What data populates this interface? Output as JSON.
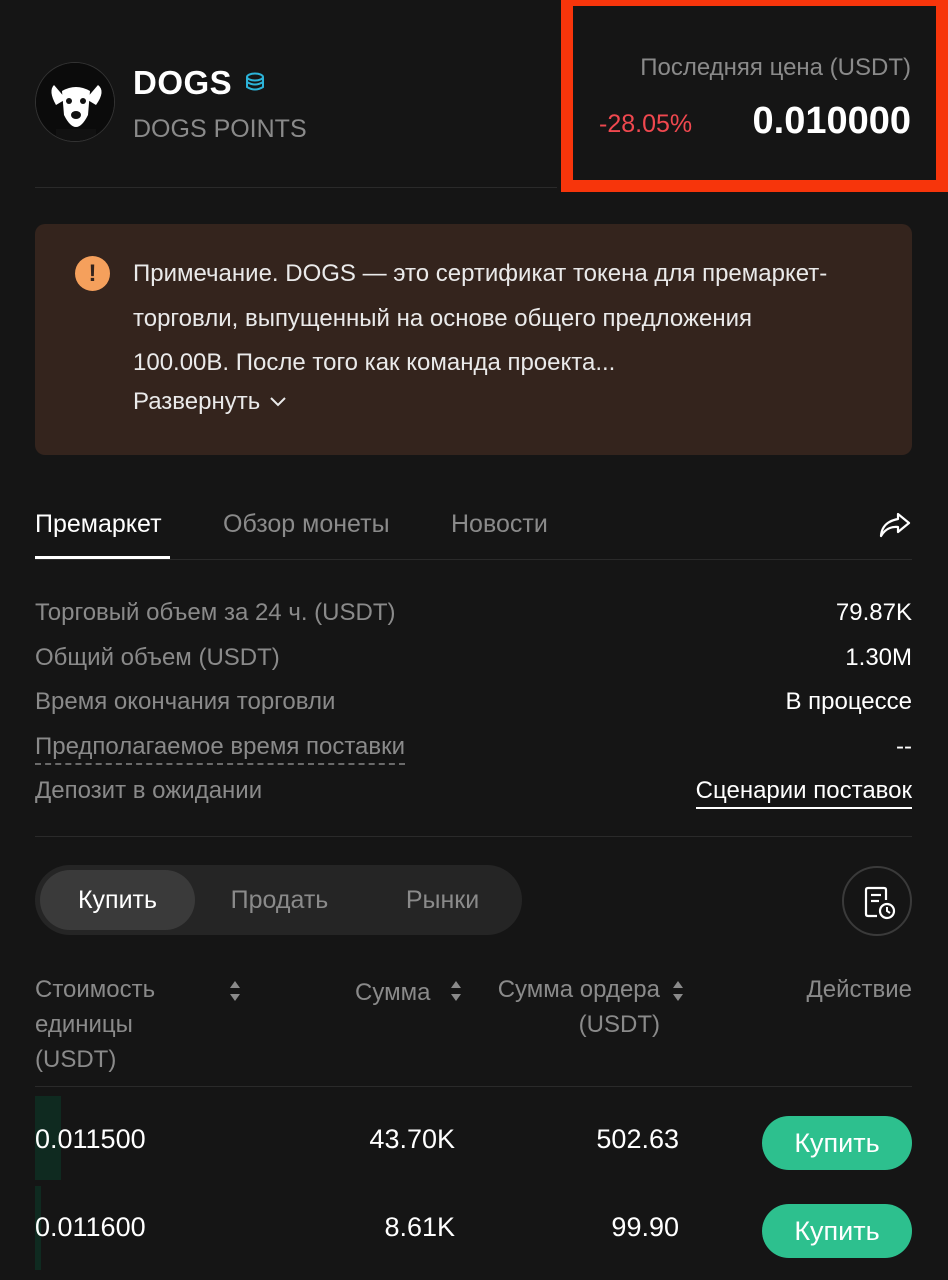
{
  "header": {
    "coin_name": "DOGS",
    "coin_subtitle": "DOGS POINTS",
    "price_label": "Последняя цена (USDT)",
    "price_change": "-28.05%",
    "price_value": "0.010000",
    "colors": {
      "negative": "#f0484f",
      "highlight_border": "#f7350b"
    }
  },
  "notice": {
    "icon": "warning-icon",
    "text": "Примечание. DOGS — это сертификат токена для премаркет-торговли, выпущенный на основе общего предложения 100.00B. После того как команда проекта...",
    "expand_label": "Развернуть"
  },
  "tabs": [
    {
      "label": "Премаркет",
      "active": true
    },
    {
      "label": "Обзор монеты",
      "active": false
    },
    {
      "label": "Новости",
      "active": false
    }
  ],
  "info": [
    {
      "label": "Торговый объем за 24 ч. (USDT)",
      "value": "79.87K"
    },
    {
      "label": "Общий объем (USDT)",
      "value": "1.30M"
    },
    {
      "label": "Время окончания торговли",
      "value": "В процессе"
    },
    {
      "label": "Предполагаемое время поставки",
      "value": "--"
    },
    {
      "label": "Депозит в ожидании",
      "value": "Сценарии поставок"
    }
  ],
  "segments": [
    {
      "label": "Купить",
      "active": true
    },
    {
      "label": "Продать",
      "active": false
    },
    {
      "label": "Рынки",
      "active": false
    }
  ],
  "table": {
    "headers": {
      "unit_price": "Стоимость единицы (USDT)",
      "amount": "Сумма",
      "order_total": "Сумма ордера (USDT)",
      "action": "Действие"
    },
    "rows": [
      {
        "price": "0.011500",
        "amount": "43.70K",
        "total": "502.63",
        "action": "Купить"
      },
      {
        "price": "0.011600",
        "amount": "8.61K",
        "total": "99.90",
        "action": "Купить"
      }
    ],
    "buy_color": "#2dc08e"
  }
}
